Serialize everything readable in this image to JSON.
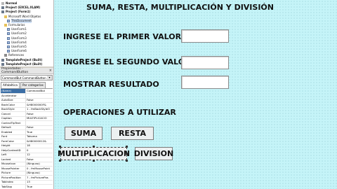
{
  "ide": {
    "tree": [
      {
        "icon": "mod-icon",
        "label": "Normal",
        "bold": true
      },
      {
        "icon": "proj-icon",
        "label": "Project (EXCEL.XLAM)",
        "bold": true
      },
      {
        "icon": "proj-icon",
        "label": "Project (Form1)",
        "bold": true
      },
      {
        "icon": "folder-icon",
        "label": "Microsoft Word Objetos",
        "bold": false
      },
      {
        "icon": "form-icon",
        "label": "ThisDocument",
        "bold": false
      },
      {
        "icon": "folder-icon",
        "label": "Formularios",
        "bold": false
      },
      {
        "icon": "form-icon",
        "label": "UserForm1",
        "bold": false
      },
      {
        "icon": "form-icon",
        "label": "UserForm2",
        "bold": false
      },
      {
        "icon": "form-icon",
        "label": "UserForm3",
        "bold": false
      },
      {
        "icon": "form-icon",
        "label": "UserForm4",
        "bold": false
      },
      {
        "icon": "form-icon",
        "label": "UserForm5",
        "bold": false
      },
      {
        "icon": "form-icon",
        "label": "UserForm6",
        "bold": false
      },
      {
        "icon": "ref-icon",
        "label": "References",
        "bold": false
      },
      {
        "icon": "proj-icon",
        "label": "TemplateProject (Built)",
        "bold": true
      },
      {
        "icon": "proj-icon",
        "label": "TemplateProject (Built)",
        "bold": true
      }
    ],
    "properties": {
      "title": "Propiedades - CommandButton",
      "close": "×",
      "object": "CommandBut CommandButton",
      "tabs": [
        "Alfabética",
        "Por categorías"
      ],
      "rows": [
        {
          "k": "(Name)",
          "v": "CommandBut"
        },
        {
          "k": "Accelerator",
          "v": ""
        },
        {
          "k": "AutoSize",
          "v": "False"
        },
        {
          "k": "BackColor",
          "v": "&H8000000F&"
        },
        {
          "k": "BackStyle",
          "v": "1 - fmBackStyleO"
        },
        {
          "k": "Cancel",
          "v": "False"
        },
        {
          "k": "Caption",
          "v": "MULTIPLICACIO"
        },
        {
          "k": "ControlTipText",
          "v": ""
        },
        {
          "k": "Default",
          "v": "False"
        },
        {
          "k": "Enabled",
          "v": "True"
        },
        {
          "k": "Font",
          "v": "Tahoma"
        },
        {
          "k": "ForeColor",
          "v": "&H80000012&"
        },
        {
          "k": "Height",
          "v": "18"
        },
        {
          "k": "HelpContextID",
          "v": "0"
        },
        {
          "k": "Left",
          "v": "12"
        },
        {
          "k": "Locked",
          "v": "False"
        },
        {
          "k": "MouseIcon",
          "v": "(Ninguno)"
        },
        {
          "k": "MousePointer",
          "v": "0 - fmMousePoint"
        },
        {
          "k": "Picture",
          "v": "(Ninguno)"
        },
        {
          "k": "PicturePosition",
          "v": "7 - fmPicturePos"
        },
        {
          "k": "TabIndex",
          "v": "13"
        },
        {
          "k": "TabStop",
          "v": "True"
        }
      ]
    }
  },
  "form": {
    "title": "SUMA, RESTA, MULTIPLICACIÓN Y DIVISIÓN",
    "label_first": "INGRESE EL PRIMER VALOR",
    "label_second": "INGRESE EL SEGUNDO VALOR",
    "label_result": "MOSTRAR RESULTADO",
    "label_ops": "OPERACIONES A UTILIZAR",
    "btn_suma": "SUMA",
    "btn_resta": "RESTA",
    "btn_mult": "MULTIPLICACION",
    "btn_div": "DIVISION",
    "colors": {
      "form_bg": "#c5f4f8",
      "selected_row": "#3b6ea5"
    }
  }
}
